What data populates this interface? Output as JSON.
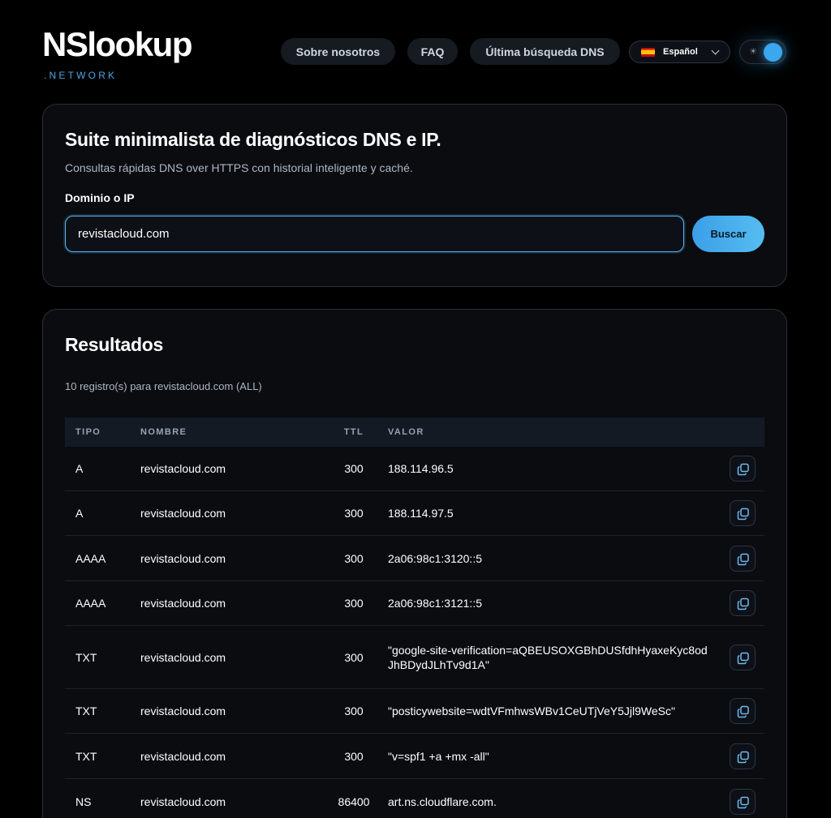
{
  "header": {
    "logo_main": "NSlookup",
    "logo_sub": ".NETWORK",
    "nav": [
      "Sobre nosotros",
      "FAQ",
      "Última búsqueda DNS"
    ],
    "language": "Español",
    "theme_toggle_icon": "sun-icon"
  },
  "search": {
    "title": "Suite minimalista de diagnósticos DNS e IP.",
    "subtitle": "Consultas rápidas DNS over HTTPS con historial inteligente y caché.",
    "label": "Dominio o IP",
    "value": "revistacloud.com",
    "button": "Buscar"
  },
  "results": {
    "title": "Resultados",
    "summary": "10 registro(s) para revistacloud.com (ALL)",
    "columns": [
      "TIPO",
      "NOMBRE",
      "TTL",
      "VALOR"
    ],
    "rows": [
      {
        "type": "A",
        "name": "revistacloud.com",
        "ttl": "300",
        "value": "188.114.96.5"
      },
      {
        "type": "A",
        "name": "revistacloud.com",
        "ttl": "300",
        "value": "188.114.97.5"
      },
      {
        "type": "AAAA",
        "name": "revistacloud.com",
        "ttl": "300",
        "value": "2a06:98c1:3120::5"
      },
      {
        "type": "AAAA",
        "name": "revistacloud.com",
        "ttl": "300",
        "value": "2a06:98c1:3121::5"
      },
      {
        "type": "TXT",
        "name": "revistacloud.com",
        "ttl": "300",
        "value": "\"google-site-verification=aQBEUSOXGBhDUSfdhHyaxeKyc8odJhBDydJLhTv9d1A\""
      },
      {
        "type": "TXT",
        "name": "revistacloud.com",
        "ttl": "300",
        "value": "\"posticywebsite=wdtVFmhwsWBv1CeUTjVeY5Jjl9WeSc\""
      },
      {
        "type": "TXT",
        "name": "revistacloud.com",
        "ttl": "300",
        "value": "\"v=spf1 +a +mx -all\""
      },
      {
        "type": "NS",
        "name": "revistacloud.com",
        "ttl": "86400",
        "value": "art.ns.cloudflare.com."
      }
    ]
  },
  "colors": {
    "accent": "#3aa7ee",
    "background": "#000000",
    "card": "#0a0c10"
  }
}
